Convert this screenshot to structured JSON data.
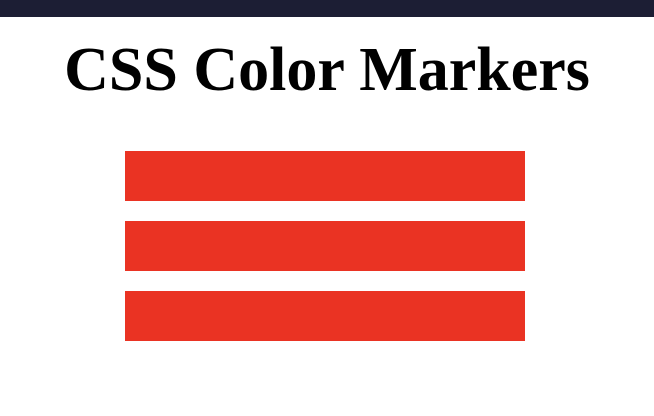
{
  "page": {
    "title": "CSS Color Markers"
  },
  "colors": {
    "top_bar": "#1c1e34",
    "background": "#ffffff",
    "title_text": "#000000"
  },
  "markers": [
    {
      "color": "#ea3323"
    },
    {
      "color": "#ea3323"
    },
    {
      "color": "#ea3323"
    }
  ]
}
